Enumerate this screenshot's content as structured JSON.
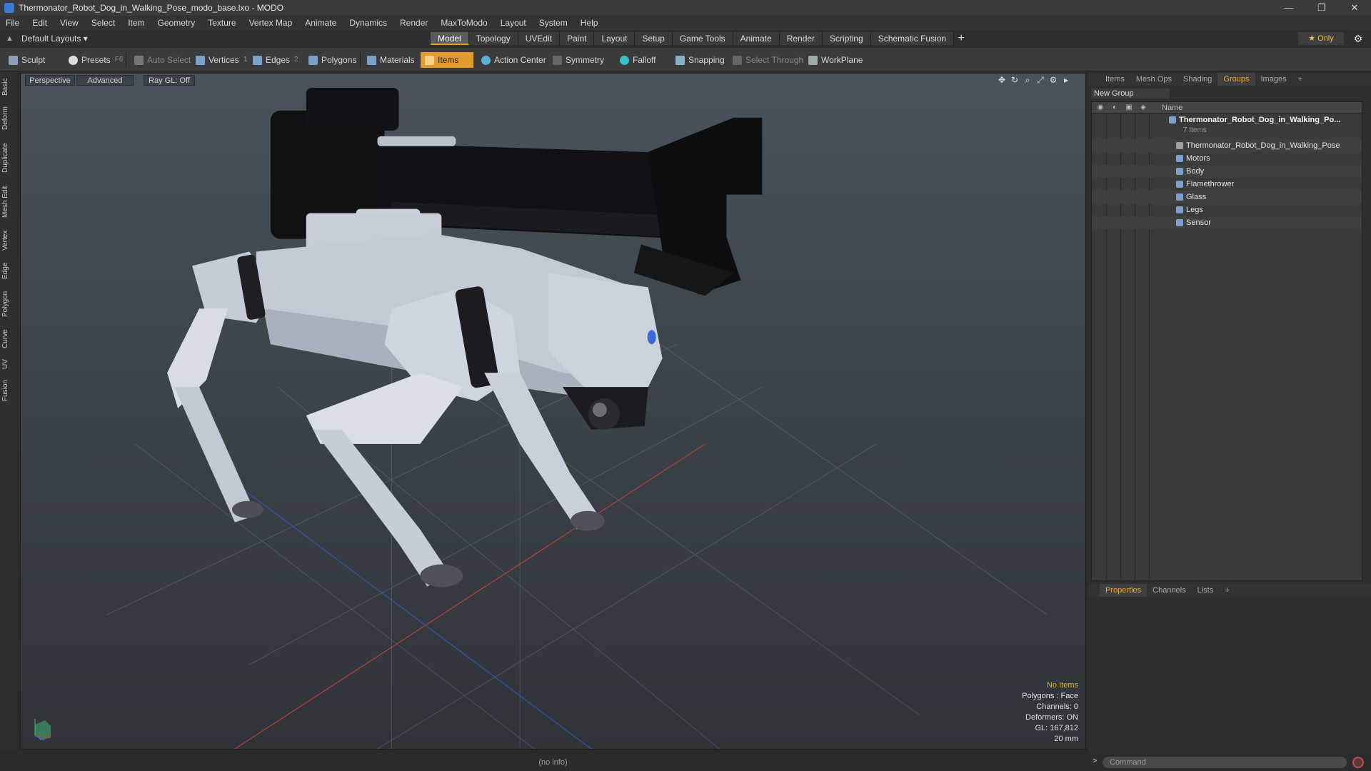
{
  "window": {
    "title": "Thermonator_Robot_Dog_in_Walking_Pose_modo_base.lxo - MODO",
    "controls": [
      "—",
      "❐",
      "✕"
    ]
  },
  "menu": [
    "File",
    "Edit",
    "View",
    "Select",
    "Item",
    "Geometry",
    "Texture",
    "Vertex Map",
    "Animate",
    "Dynamics",
    "Render",
    "MaxToModo",
    "Layout",
    "System",
    "Help"
  ],
  "layout_dropdown": "Default Layouts ▾",
  "mode_tabs": [
    "Model",
    "Topology",
    "UVEdit",
    "Paint",
    "Layout",
    "Setup",
    "Game Tools",
    "Animate",
    "Render",
    "Scripting",
    "Schematic Fusion"
  ],
  "active_tab": "Model",
  "only_label": "★  Only",
  "toolbar": {
    "sculpt": "Sculpt",
    "presets": "Presets",
    "presets_key": "F6",
    "auto_select": "Auto Select",
    "vertices": "Vertices",
    "vertices_key": "1",
    "edges": "Edges",
    "edges_key": "2",
    "polygons": "Polygons",
    "materials": "Materials",
    "items": "Items",
    "action_center": "Action Center",
    "symmetry": "Symmetry",
    "falloff": "Falloff",
    "snapping": "Snapping",
    "select_through": "Select Through",
    "workplane": "WorkPlane"
  },
  "left_tabs": [
    "Basic",
    "Deform",
    "Duplicate",
    "Mesh Edit",
    "Vertex",
    "Edge",
    "Polygon",
    "Curve",
    "UV",
    "Fusion"
  ],
  "viewport": {
    "view": "Perspective",
    "shading": "Advanced",
    "raygl": "Ray GL: Off",
    "stats": {
      "selection": "No Items",
      "polygons": "Polygons : Face",
      "channels": "Channels: 0",
      "deformers": "Deformers: ON",
      "gl": "GL: 167,812",
      "scale": "20 mm"
    }
  },
  "status_info": "(no info)",
  "right_panel": {
    "tabs": [
      "Items",
      "Mesh Ops",
      "Shading",
      "Groups",
      "Images",
      "+"
    ],
    "active_tab": "Groups",
    "new_group": "New Group",
    "name_header": "Name",
    "group": {
      "name": "Thermonator_Robot_Dog_in_Walking_Po...",
      "count": "7 Items"
    },
    "items": [
      "Thermonator_Robot_Dog_in_Walking_Pose",
      "Motors",
      "Body",
      "Flamethrower",
      "Glass",
      "Legs",
      "Sensor"
    ],
    "prop_tabs": [
      "Properties",
      "Channels",
      "Lists",
      "+"
    ],
    "active_prop_tab": "Properties",
    "command_placeholder": "Command"
  },
  "colors": {
    "accent": "#e39a2e",
    "viewport_top": "#4a535b",
    "viewport_bottom": "#2f3439"
  }
}
